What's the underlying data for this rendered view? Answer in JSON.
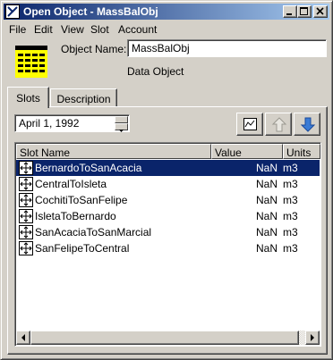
{
  "window": {
    "title": "Open Object - MassBalObj"
  },
  "menu": [
    "File",
    "Edit",
    "View",
    "Slot",
    "Account"
  ],
  "header": {
    "object_name_label": "Object Name:",
    "object_name_value": "MassBalObj",
    "object_type": "Data Object"
  },
  "tabs": [
    {
      "label": "Slots",
      "active": true
    },
    {
      "label": "Description",
      "active": false
    }
  ],
  "date": {
    "value": "April 1, 1992"
  },
  "table": {
    "columns": [
      "Slot Name",
      "Value",
      "Units"
    ],
    "rows": [
      {
        "name": "BernardoToSanAcacia",
        "value": "NaN",
        "units": "m3",
        "selected": true
      },
      {
        "name": "CentralToIsleta",
        "value": "NaN",
        "units": "m3",
        "selected": false
      },
      {
        "name": "CochitiToSanFelipe",
        "value": "NaN",
        "units": "m3",
        "selected": false
      },
      {
        "name": "IsletaToBernardo",
        "value": "NaN",
        "units": "m3",
        "selected": false
      },
      {
        "name": "SanAcaciaToSanMarcial",
        "value": "NaN",
        "units": "m3",
        "selected": false
      },
      {
        "name": "SanFelipeToCentral",
        "value": "NaN",
        "units": "m3",
        "selected": false
      }
    ]
  },
  "icons": {
    "app": "riverware-app-icon",
    "object": "data-object-grid-icon",
    "slot": "slot-arrows-icon",
    "toolbar": [
      "plot-icon",
      "arrow-up-icon",
      "arrow-down-icon"
    ]
  },
  "colors": {
    "selection": "#0a246a",
    "face": "#d4d0c8"
  }
}
